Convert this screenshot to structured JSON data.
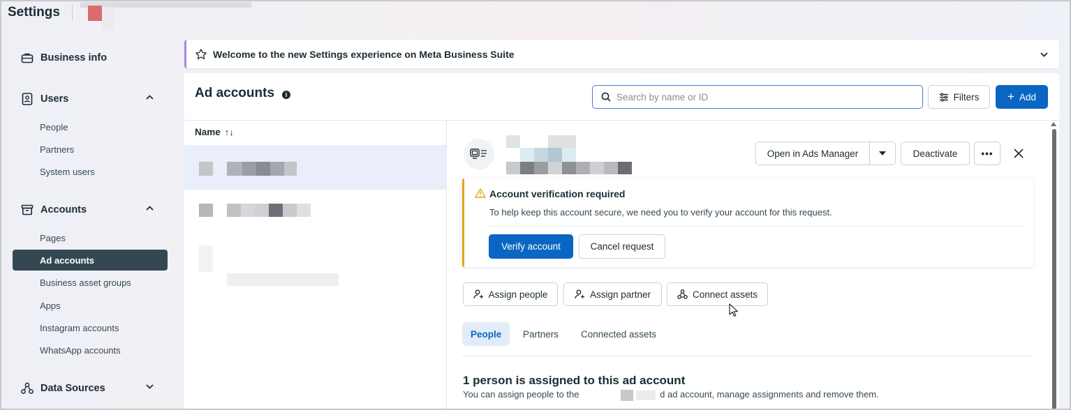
{
  "app": {
    "title": "Settings"
  },
  "sidebar": {
    "business_info": "Business info",
    "users": {
      "label": "Users",
      "items": [
        "People",
        "Partners",
        "System users"
      ]
    },
    "accounts": {
      "label": "Accounts",
      "items": [
        "Pages",
        "Ad accounts",
        "Business asset groups",
        "Apps",
        "Instagram accounts",
        "WhatsApp accounts"
      ],
      "active": "Ad accounts"
    },
    "data_sources": "Data Sources"
  },
  "banner": {
    "text": "Welcome to the new Settings experience on Meta Business Suite"
  },
  "main": {
    "title": "Ad accounts",
    "info_glyph": "i",
    "search": {
      "placeholder": "Search by name or ID",
      "value": ""
    },
    "filters_label": "Filters",
    "add_label": "Add",
    "list": {
      "column_name": "Name",
      "sort_glyph": "↑↓"
    }
  },
  "detail": {
    "open_in_ads_manager": "Open in Ads Manager",
    "deactivate": "Deactivate",
    "more": "•••",
    "alert": {
      "title": "Account verification required",
      "body": "To help keep this account secure, we need you to verify your account for this request.",
      "verify_label": "Verify account",
      "cancel_label": "Cancel request"
    },
    "actions": {
      "assign_people": "Assign people",
      "assign_partner": "Assign partner",
      "connect_assets": "Connect assets"
    },
    "tabs": [
      "People",
      "Partners",
      "Connected assets"
    ],
    "active_tab": "People",
    "assigned_title": "1 person is assigned to this ad account",
    "assigned_body_prefix": "You can assign people to the",
    "assigned_body_suffix": "d ad account, manage assignments and remove them."
  },
  "colors": {
    "primary": "#0a66c2",
    "sidebar_active": "#344854",
    "warning": "#e8a317",
    "banner_accent": "#a78bda"
  }
}
